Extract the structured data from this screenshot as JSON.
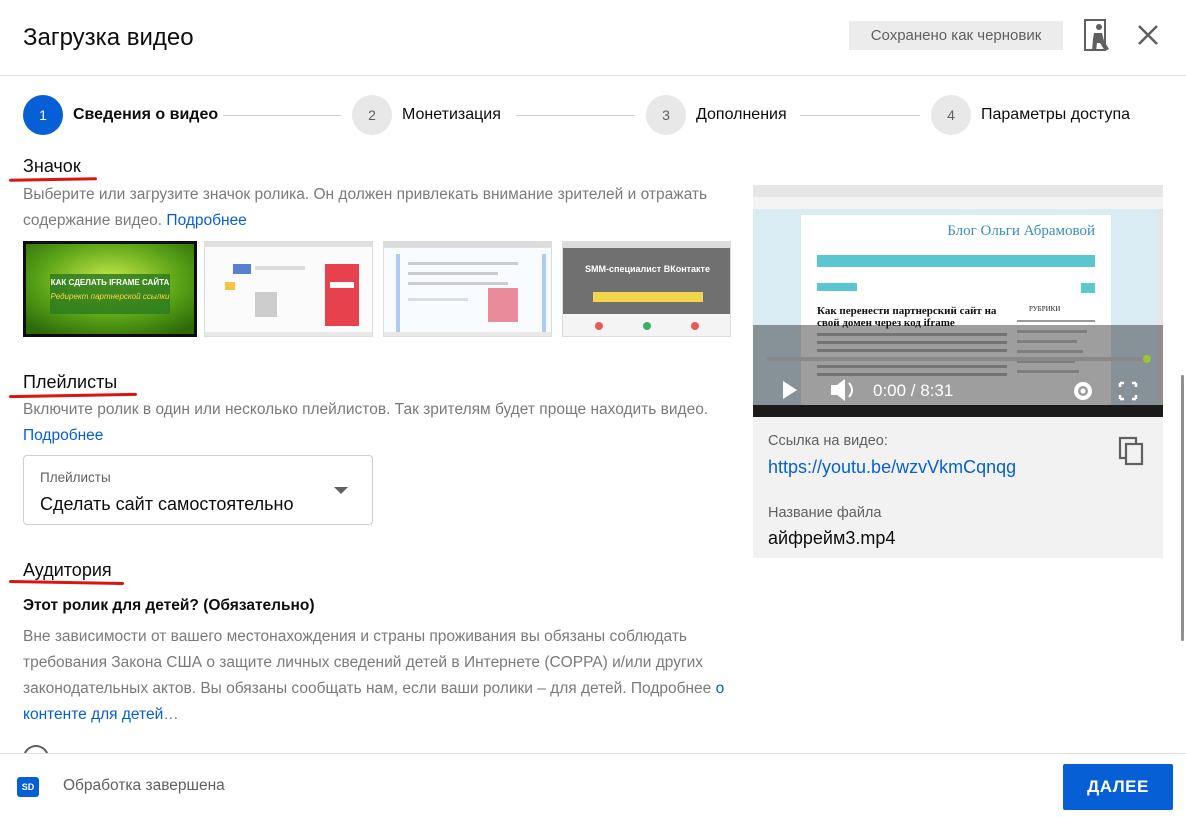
{
  "header": {
    "title": "Загрузка видео",
    "draft_status": "Сохранено как черновик",
    "help_icon": "feedback-person-icon",
    "close_icon": "close-icon"
  },
  "stepper": {
    "steps": [
      {
        "number": "1",
        "label": "Сведения о видео",
        "active": true
      },
      {
        "number": "2",
        "label": "Монетизация",
        "active": false
      },
      {
        "number": "3",
        "label": "Дополнения",
        "active": false
      },
      {
        "number": "4",
        "label": "Параметры доступа",
        "active": false
      }
    ]
  },
  "thumbnail_section": {
    "title": "Значок",
    "description": "Выберите или загрузите значок ролика. Он должен привлекать внимание зрителей и отражать содержание видео.",
    "more_link": "Подробнее",
    "thumb1_line1": "КАК СДЕЛАТЬ IFRAME САЙТА",
    "thumb1_line2": "Редирект партнерской ссылки",
    "thumb4_title": "SMM-специалист ВКонтакте",
    "annotation_color": "#e01111"
  },
  "playlist_section": {
    "title": "Плейлисты",
    "description": "Включите ролик в один или несколько плейлистов. Так зрителям будет проще находить видео.",
    "more_link": "Подробнее",
    "dropdown_label": "Плейлисты",
    "dropdown_value": "Сделать сайт самостоятельно"
  },
  "audience_section": {
    "title": "Аудитория",
    "question": "Этот ролик для детей? (Обязательно)",
    "description": "Вне зависимости от вашего местонахождения и страны проживания вы обязаны соблюдать требования Закона США о защите личных сведений детей в Интернете (COPPA) и/или других законодательных актов. Вы обязаны сообщать нам, если ваши ролики – для детей. Подробнее",
    "more_link": "о контенте для детей",
    "ellipsis": "…"
  },
  "video_card": {
    "blog_title": "Блог Ольги Абрамовой",
    "article_title": "Как перенести партнерский сайт на свой домен через код iframe",
    "sidebar_heading": "РУБРИКИ",
    "time": "0:00 / 8:31",
    "progress": 0.0,
    "link_label": "Ссылка на видео:",
    "link": "https://youtu.be/wzvVkmCqnqg",
    "file_label": "Название файла",
    "file_name": "айфрейм3.mp4"
  },
  "footer": {
    "quality_badge": "SD",
    "status": "Обработка завершена",
    "next_button": "ДАЛЕЕ"
  },
  "colors": {
    "accent": "#065fd4",
    "annotation": "#e01111"
  }
}
